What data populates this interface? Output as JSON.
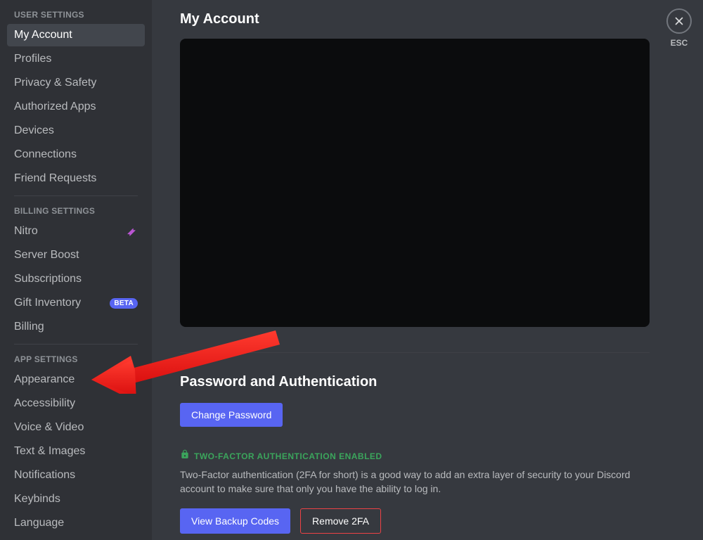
{
  "sidebar": {
    "sections": [
      {
        "header": "User Settings",
        "items": [
          {
            "label": "My Account",
            "active": true
          },
          {
            "label": "Profiles"
          },
          {
            "label": "Privacy & Safety"
          },
          {
            "label": "Authorized Apps"
          },
          {
            "label": "Devices"
          },
          {
            "label": "Connections"
          },
          {
            "label": "Friend Requests"
          }
        ]
      },
      {
        "header": "Billing Settings",
        "items": [
          {
            "label": "Nitro",
            "icon": "nitro"
          },
          {
            "label": "Server Boost"
          },
          {
            "label": "Subscriptions"
          },
          {
            "label": "Gift Inventory",
            "badge": "BETA"
          },
          {
            "label": "Billing"
          }
        ]
      },
      {
        "header": "App Settings",
        "items": [
          {
            "label": "Appearance"
          },
          {
            "label": "Accessibility"
          },
          {
            "label": "Voice & Video"
          },
          {
            "label": "Text & Images"
          },
          {
            "label": "Notifications"
          },
          {
            "label": "Keybinds"
          },
          {
            "label": "Language"
          }
        ]
      }
    ]
  },
  "main": {
    "title": "My Account",
    "password_section_title": "Password and Authentication",
    "change_password_label": "Change Password",
    "twofa_label": "Two-Factor Authentication Enabled",
    "twofa_desc": "Two-Factor authentication (2FA for short) is a good way to add an extra layer of security to your Discord account to make sure that only you have the ability to log in.",
    "view_backup_label": "View Backup Codes",
    "remove_2fa_label": "Remove 2FA"
  },
  "close": {
    "esc": "ESC"
  }
}
